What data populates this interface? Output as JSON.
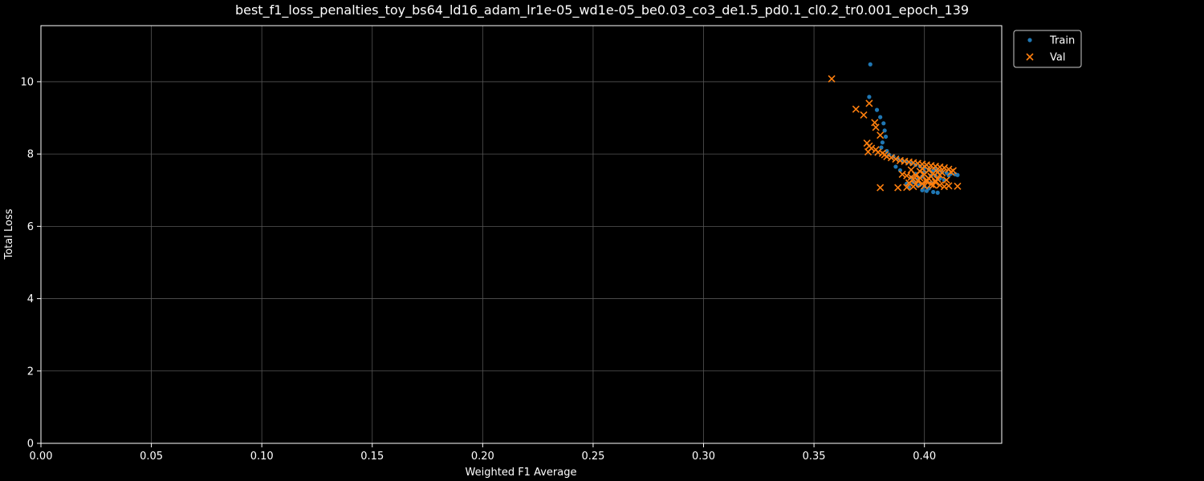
{
  "chart_data": {
    "type": "scatter",
    "title": "best_f1_loss_penalties_toy_bs64_ld16_adam_lr1e-05_wd1e-05_be0.03_co3_de1.5_pd0.1_cl0.2_tr0.001_epoch_139",
    "xlabel": "Weighted F1 Average",
    "ylabel": "Total Loss",
    "xlim": [
      0,
      0.435
    ],
    "ylim": [
      0,
      11.55
    ],
    "xticks": [
      0.0,
      0.05,
      0.1,
      0.15,
      0.2,
      0.25,
      0.3,
      0.35,
      0.4
    ],
    "xtick_labels": [
      "0.00",
      "0.05",
      "0.10",
      "0.15",
      "0.20",
      "0.25",
      "0.30",
      "0.35",
      "0.40"
    ],
    "yticks": [
      0,
      2,
      4,
      6,
      8,
      10
    ],
    "ytick_labels": [
      "0",
      "2",
      "4",
      "6",
      "8",
      "10"
    ],
    "grid": true,
    "legend_position": "outside-top-right",
    "colors": {
      "background": "#000000",
      "foreground": "#ffffff",
      "grid": "#555555"
    },
    "series": [
      {
        "name": "Train",
        "marker": "circle",
        "color": "#1f77b4",
        "points": [
          [
            0.3755,
            10.48
          ],
          [
            0.375,
            9.58
          ],
          [
            0.3785,
            9.22
          ],
          [
            0.38,
            9.02
          ],
          [
            0.3815,
            8.85
          ],
          [
            0.382,
            8.65
          ],
          [
            0.3825,
            8.48
          ],
          [
            0.381,
            8.32
          ],
          [
            0.3805,
            8.18
          ],
          [
            0.383,
            8.08
          ],
          [
            0.384,
            7.98
          ],
          [
            0.386,
            7.93
          ],
          [
            0.388,
            7.87
          ],
          [
            0.39,
            7.82
          ],
          [
            0.392,
            7.78
          ],
          [
            0.394,
            7.74
          ],
          [
            0.396,
            7.7
          ],
          [
            0.398,
            7.66
          ],
          [
            0.4,
            7.62
          ],
          [
            0.402,
            7.58
          ],
          [
            0.404,
            7.55
          ],
          [
            0.406,
            7.52
          ],
          [
            0.408,
            7.5
          ],
          [
            0.41,
            7.48
          ],
          [
            0.412,
            7.46
          ],
          [
            0.414,
            7.44
          ],
          [
            0.415,
            7.42
          ],
          [
            0.411,
            7.41
          ],
          [
            0.405,
            7.4
          ],
          [
            0.399,
            7.38
          ],
          [
            0.397,
            7.3
          ],
          [
            0.401,
            7.25
          ],
          [
            0.403,
            7.2
          ],
          [
            0.398,
            7.15
          ],
          [
            0.4,
            7.1
          ],
          [
            0.402,
            7.05
          ],
          [
            0.399,
            7.0
          ],
          [
            0.401,
            6.98
          ],
          [
            0.404,
            6.95
          ],
          [
            0.406,
            6.93
          ],
          [
            0.397,
            7.12
          ],
          [
            0.395,
            7.22
          ],
          [
            0.394,
            7.35
          ],
          [
            0.396,
            7.45
          ],
          [
            0.407,
            7.32
          ],
          [
            0.409,
            7.28
          ],
          [
            0.392,
            7.18
          ],
          [
            0.393,
            7.08
          ],
          [
            0.389,
            7.55
          ],
          [
            0.387,
            7.65
          ],
          [
            0.4,
            7.5
          ],
          [
            0.403,
            7.4
          ],
          [
            0.405,
            7.6
          ]
        ]
      },
      {
        "name": "Val",
        "marker": "x",
        "color": "#ff7f0e",
        "points": [
          [
            0.358,
            10.08
          ],
          [
            0.375,
            9.4
          ],
          [
            0.369,
            9.24
          ],
          [
            0.3725,
            9.08
          ],
          [
            0.3775,
            8.87
          ],
          [
            0.378,
            8.74
          ],
          [
            0.38,
            8.52
          ],
          [
            0.374,
            8.3
          ],
          [
            0.375,
            8.22
          ],
          [
            0.376,
            8.16
          ],
          [
            0.3745,
            8.06
          ],
          [
            0.378,
            8.12
          ],
          [
            0.379,
            8.05
          ],
          [
            0.381,
            8.02
          ],
          [
            0.382,
            7.98
          ],
          [
            0.383,
            7.93
          ],
          [
            0.385,
            7.9
          ],
          [
            0.387,
            7.86
          ],
          [
            0.389,
            7.82
          ],
          [
            0.391,
            7.8
          ],
          [
            0.393,
            7.78
          ],
          [
            0.395,
            7.76
          ],
          [
            0.397,
            7.74
          ],
          [
            0.399,
            7.72
          ],
          [
            0.401,
            7.7
          ],
          [
            0.403,
            7.68
          ],
          [
            0.405,
            7.66
          ],
          [
            0.407,
            7.64
          ],
          [
            0.409,
            7.62
          ],
          [
            0.411,
            7.58
          ],
          [
            0.413,
            7.54
          ],
          [
            0.412,
            7.5
          ],
          [
            0.408,
            7.48
          ],
          [
            0.404,
            7.46
          ],
          [
            0.4,
            7.44
          ],
          [
            0.396,
            7.42
          ],
          [
            0.392,
            7.4
          ],
          [
            0.394,
            7.36
          ],
          [
            0.398,
            7.34
          ],
          [
            0.402,
            7.32
          ],
          [
            0.406,
            7.3
          ],
          [
            0.41,
            7.28
          ],
          [
            0.397,
            7.26
          ],
          [
            0.401,
            7.24
          ],
          [
            0.405,
            7.22
          ],
          [
            0.393,
            7.2
          ],
          [
            0.399,
            7.18
          ],
          [
            0.403,
            7.16
          ],
          [
            0.407,
            7.14
          ],
          [
            0.411,
            7.12
          ],
          [
            0.415,
            7.11
          ],
          [
            0.409,
            7.1
          ],
          [
            0.395,
            7.1
          ],
          [
            0.392,
            7.08
          ],
          [
            0.388,
            7.07
          ],
          [
            0.38,
            7.07
          ],
          [
            0.4,
            7.12
          ],
          [
            0.404,
            7.14
          ],
          [
            0.396,
            7.16
          ],
          [
            0.398,
            7.52
          ],
          [
            0.402,
            7.55
          ],
          [
            0.406,
            7.5
          ],
          [
            0.394,
            7.56
          ],
          [
            0.39,
            7.44
          ],
          [
            0.399,
            7.6
          ],
          [
            0.403,
            7.38
          ],
          [
            0.407,
            7.42
          ],
          [
            0.395,
            7.3
          ],
          [
            0.401,
            7.28
          ],
          [
            0.405,
            7.26
          ]
        ]
      }
    ]
  }
}
